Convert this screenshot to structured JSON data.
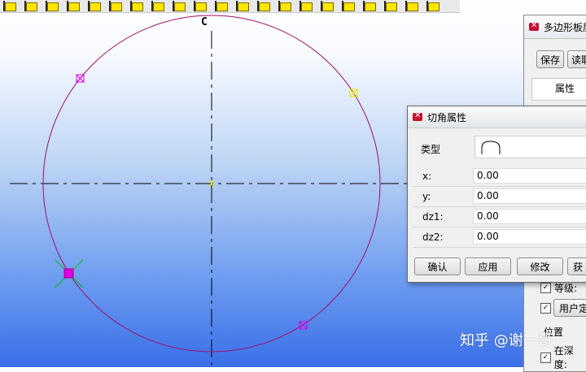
{
  "toolbar": {
    "icons": [
      "draw-tool-icon",
      "draw-tool-icon",
      "draw-tool-icon",
      "draw-tool-icon",
      "draw-tool-icon",
      "draw-tool-icon",
      "draw-tool-icon",
      "draw-tool-icon",
      "draw-tool-icon",
      "draw-tool-icon",
      "draw-tool-icon",
      "draw-tool-icon",
      "draw-tool-icon",
      "draw-tool-icon",
      "draw-tool-icon",
      "draw-tool-icon",
      "draw-tool-icon",
      "draw-tool-icon",
      "draw-tool-icon",
      "draw-tool-icon",
      "draw-tool-icon"
    ]
  },
  "canvas": {
    "center_label": "C",
    "colors": {
      "circle": "#a0106c",
      "axis": "#000000",
      "marker": "#e000e0",
      "marker_light": "#e6e600",
      "cursor": "#00c000"
    }
  },
  "panel": {
    "title": "多边形板层",
    "save_label": "保存",
    "read_label": "读取",
    "tab_label": "属性",
    "level_label": "等级:",
    "user_btn_label": "用户定",
    "position_label": "位置",
    "depth_label": "在深度:"
  },
  "dialog": {
    "title": "切角属性",
    "type_label": "类型",
    "fields": [
      {
        "label": "x:",
        "value": "0.00"
      },
      {
        "label": "y:",
        "value": "0.00"
      },
      {
        "label": "dz1:",
        "value": "0.00"
      },
      {
        "label": "dz2:",
        "value": "0.00"
      }
    ],
    "buttons": {
      "confirm": "确认",
      "apply": "应用",
      "modify": "修改",
      "fourth": "获"
    }
  },
  "watermark": "知乎 @谢一哥"
}
